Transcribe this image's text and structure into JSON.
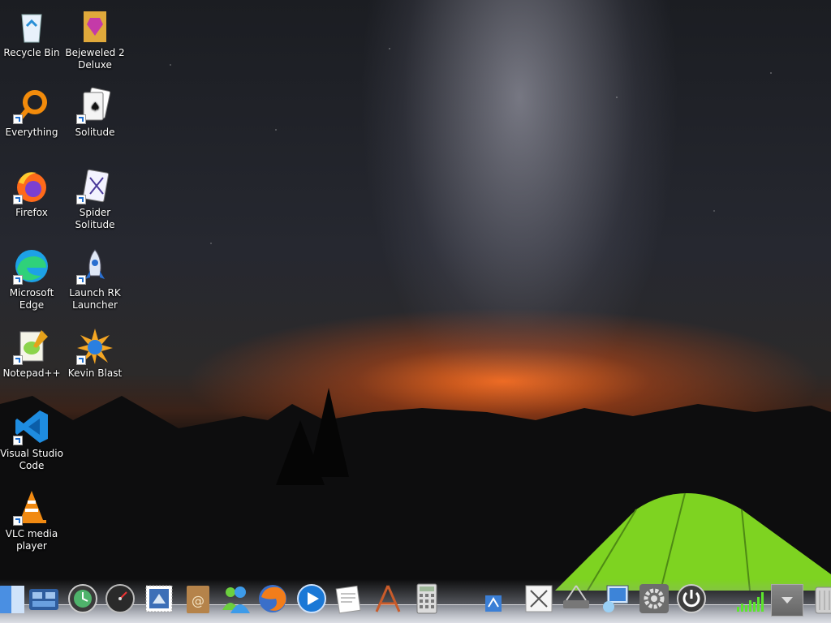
{
  "desktop": {
    "icons": [
      {
        "label": "Recycle Bin",
        "icon": "recycle-bin-icon"
      },
      {
        "label": "Bejeweled 2 Deluxe",
        "icon": "bejeweled-icon"
      },
      {
        "label": "Everything",
        "icon": "everything-search-icon"
      },
      {
        "label": "Solitude",
        "icon": "solitude-cards-icon"
      },
      {
        "label": "Firefox",
        "icon": "firefox-icon"
      },
      {
        "label": "Spider Solitude",
        "icon": "spider-solitude-icon"
      },
      {
        "label": "Microsoft Edge",
        "icon": "edge-icon"
      },
      {
        "label": "Launch RK Launcher",
        "icon": "rk-launcher-rocket-icon"
      },
      {
        "label": "Notepad++",
        "icon": "notepad-plus-plus-icon"
      },
      {
        "label": "Kevin Blast",
        "icon": "kevin-blast-icon"
      },
      {
        "label": "Visual Studio Code",
        "icon": "vscode-icon"
      },
      {
        "label": "VLC media player",
        "icon": "vlc-icon"
      }
    ]
  },
  "dock": {
    "items": [
      "finder-icon",
      "dashboard-icon",
      "time-machine-icon",
      "activity-monitor-icon",
      "mail-stamp-icon",
      "address-book-icon",
      "messenger-icon",
      "firefox-dock-icon",
      "quicktime-player-icon",
      "textedit-icon",
      "app-store-icon",
      "calculator-icon",
      "applications-folder-icon",
      "grapher-icon",
      "network-icon",
      "preview-icon",
      "system-preferences-icon",
      "power-icon",
      "cpu-meter-icon",
      "expand-arrow-icon",
      "trash-icon"
    ]
  },
  "colors": {
    "tent": "#7ed321",
    "horizon": "#ff7a1e",
    "sky": "#1f2026"
  }
}
